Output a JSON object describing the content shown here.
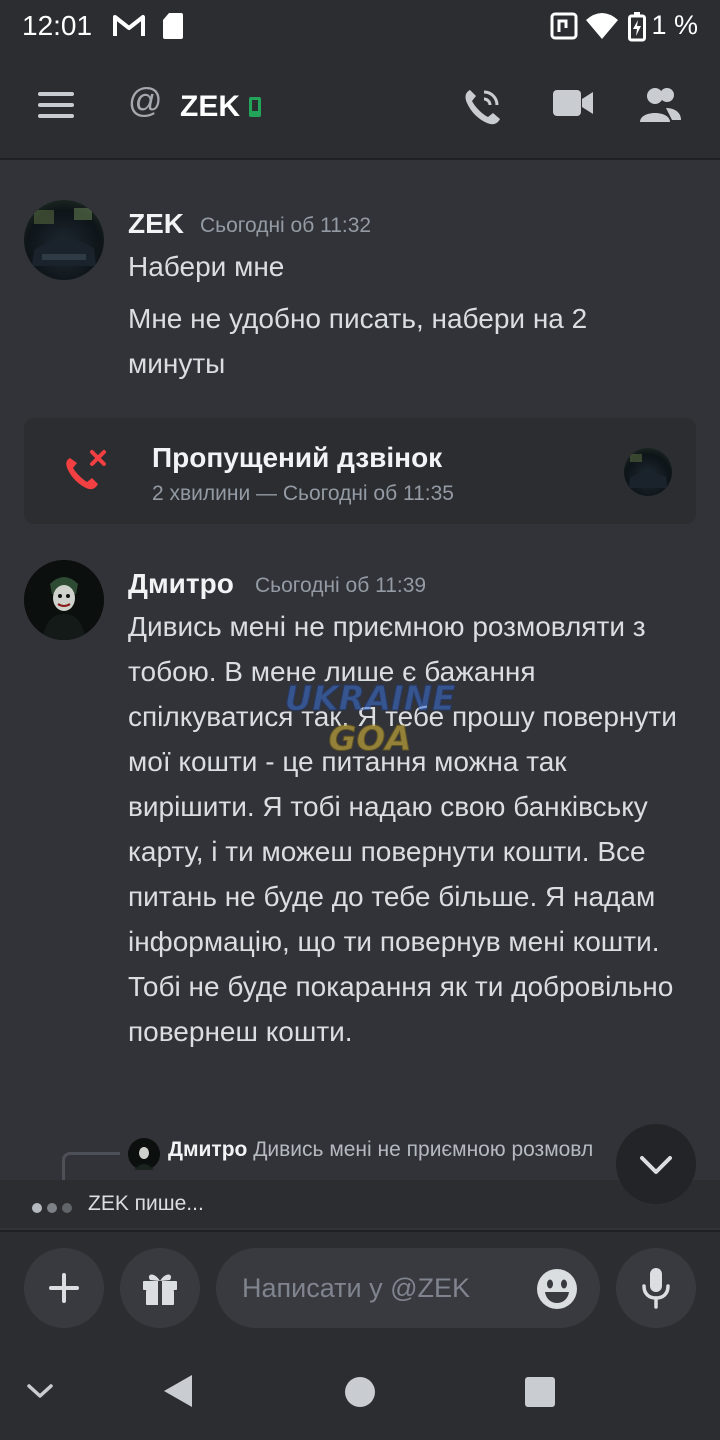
{
  "statusbar": {
    "time": "12:01",
    "battery": "1 %",
    "icons": [
      "gmail-icon",
      "sd-card-icon",
      "nfc-icon",
      "wifi-icon",
      "battery-charging-icon"
    ]
  },
  "header": {
    "title": "ZEK",
    "prefix_icon": "at-icon",
    "status_icon": "mobile-online-icon",
    "actions": [
      "voice-call-icon",
      "video-call-icon",
      "members-icon"
    ]
  },
  "messages": [
    {
      "author": "ZEK",
      "timestamp": "Сьогодні об 11:32",
      "lines": [
        "Набери мне",
        "Мне не удобно писать, набери на 2 минуты"
      ]
    },
    {
      "author": "Дмитро",
      "timestamp": "Сьогодні об 11:39",
      "text": "Дивись мені не приємною розмовляти з тобою. В мене лише є бажання спілкуватися так. Я тебе прошу повернути мої кошти - це питання можна так вирішити. Я тобі надаю свою банківську карту, і ти можеш повернути кошти. Все питань не буде до тебе більше. Я надам інформацію, що ти повернув мені кошти. Тобі не буде покарання як ти добровільно повернеш кошти."
    }
  ],
  "missed_call": {
    "title": "Пропущений дзвінок",
    "subtitle": "2 хвилини — Сьогодні об 11:35"
  },
  "reply_preview": {
    "author": "Дмитро",
    "text": "Дивись мені не приємною розмовл"
  },
  "typing": {
    "text": "ZEK пише..."
  },
  "composer": {
    "placeholder": "Написати у @ZEK"
  },
  "colors": {
    "background": "#313338",
    "bar": "#2b2d31",
    "missed_call_red": "#f23f42",
    "online_green": "#23a559"
  }
}
